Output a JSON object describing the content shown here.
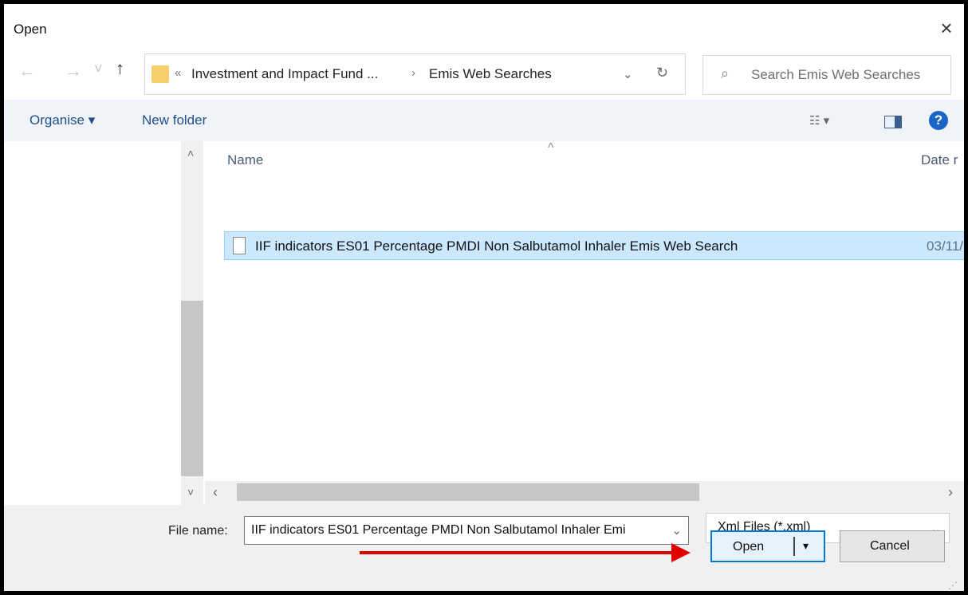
{
  "window": {
    "title": "Open",
    "close_icon": "×"
  },
  "nav": {
    "back_icon": "←",
    "forward_icon": "→",
    "recent_icon": "˅",
    "up_icon": "↑",
    "addr_dropdown_icon": "⌄",
    "refresh_icon": "↻"
  },
  "address": {
    "overflow": "«",
    "crumb1": "Investment and Impact Fund ...",
    "sep": "›",
    "crumb2": "Emis Web Searches"
  },
  "search": {
    "icon": "⌕",
    "placeholder": "Search Emis Web Searches"
  },
  "toolbar": {
    "organise": "Organise ▾",
    "new_folder": "New folder",
    "view_icon": "☷ ▾",
    "help_icon": "?"
  },
  "list": {
    "col_name": "Name",
    "sort_caret": "^",
    "col_date": "Date r",
    "items": [
      {
        "name": "IIF indicators ES01 Percentage PMDI Non Salbutamol Inhaler Emis Web Search",
        "date": "03/11/"
      }
    ]
  },
  "scroll": {
    "up": "˄",
    "down": "˅",
    "left": "‹",
    "right": "›"
  },
  "footer": {
    "file_name_label": "File name:",
    "file_name_value": "IIF indicators ES01 Percentage PMDI Non Salbutamol Inhaler Emi",
    "file_name_arrow": "⌄",
    "file_type": "Xml Files (*.xml)",
    "file_type_arrow": "⌄",
    "open_label": "Open",
    "open_split_arrow": "▾",
    "cancel_label": "Cancel",
    "grip": "⋰"
  },
  "annotation": {
    "arrow_color": "#e00000"
  }
}
